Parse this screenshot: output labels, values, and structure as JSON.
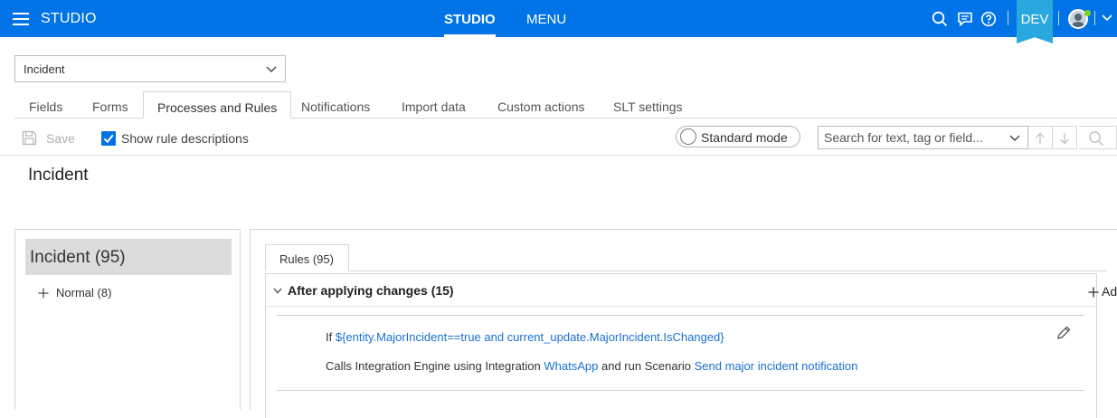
{
  "header": {
    "app_title": "STUDIO",
    "nav_tabs": [
      "STUDIO",
      "MENU"
    ],
    "active_nav": "STUDIO",
    "environment_badge": "DEV",
    "brand_color": "#0073e7",
    "badge_color": "#29a8e0",
    "icons": [
      "hamburger-icon",
      "search-icon",
      "chat-icon",
      "help-icon",
      "avatar",
      "chevron-down-icon"
    ]
  },
  "entity_select": {
    "value": "Incident"
  },
  "tabs": [
    {
      "label": "Fields",
      "active": false
    },
    {
      "label": "Forms",
      "active": false
    },
    {
      "label": "Processes and Rules",
      "active": true
    },
    {
      "label": "Notifications",
      "active": false
    },
    {
      "label": "Import data",
      "active": false
    },
    {
      "label": "Custom actions",
      "active": false
    },
    {
      "label": "SLT settings",
      "active": false
    }
  ],
  "toolbar": {
    "save_label": "Save",
    "save_enabled": false,
    "show_descriptions_label": "Show rule descriptions",
    "show_descriptions_checked": true,
    "mode_label": "Standard mode",
    "search_placeholder": "Search for text, tag or field..."
  },
  "page_title": "Incident",
  "tree": {
    "root_label": "Incident (95)",
    "children": [
      {
        "label": "Normal (8)"
      }
    ]
  },
  "rules": {
    "tab_label": "Rules (95)",
    "group": {
      "title": "After applying changes (15)",
      "add_label": "Add",
      "rule": {
        "if_prefix": "If",
        "condition": "${entity.MajorIncident==true and current_update.MajorIncident.IsChanged}",
        "calls_prefix": "Calls Integration Engine using Integration",
        "integration": "WhatsApp",
        "run_text": "and run Scenario",
        "scenario": "Send major incident notification"
      }
    }
  }
}
